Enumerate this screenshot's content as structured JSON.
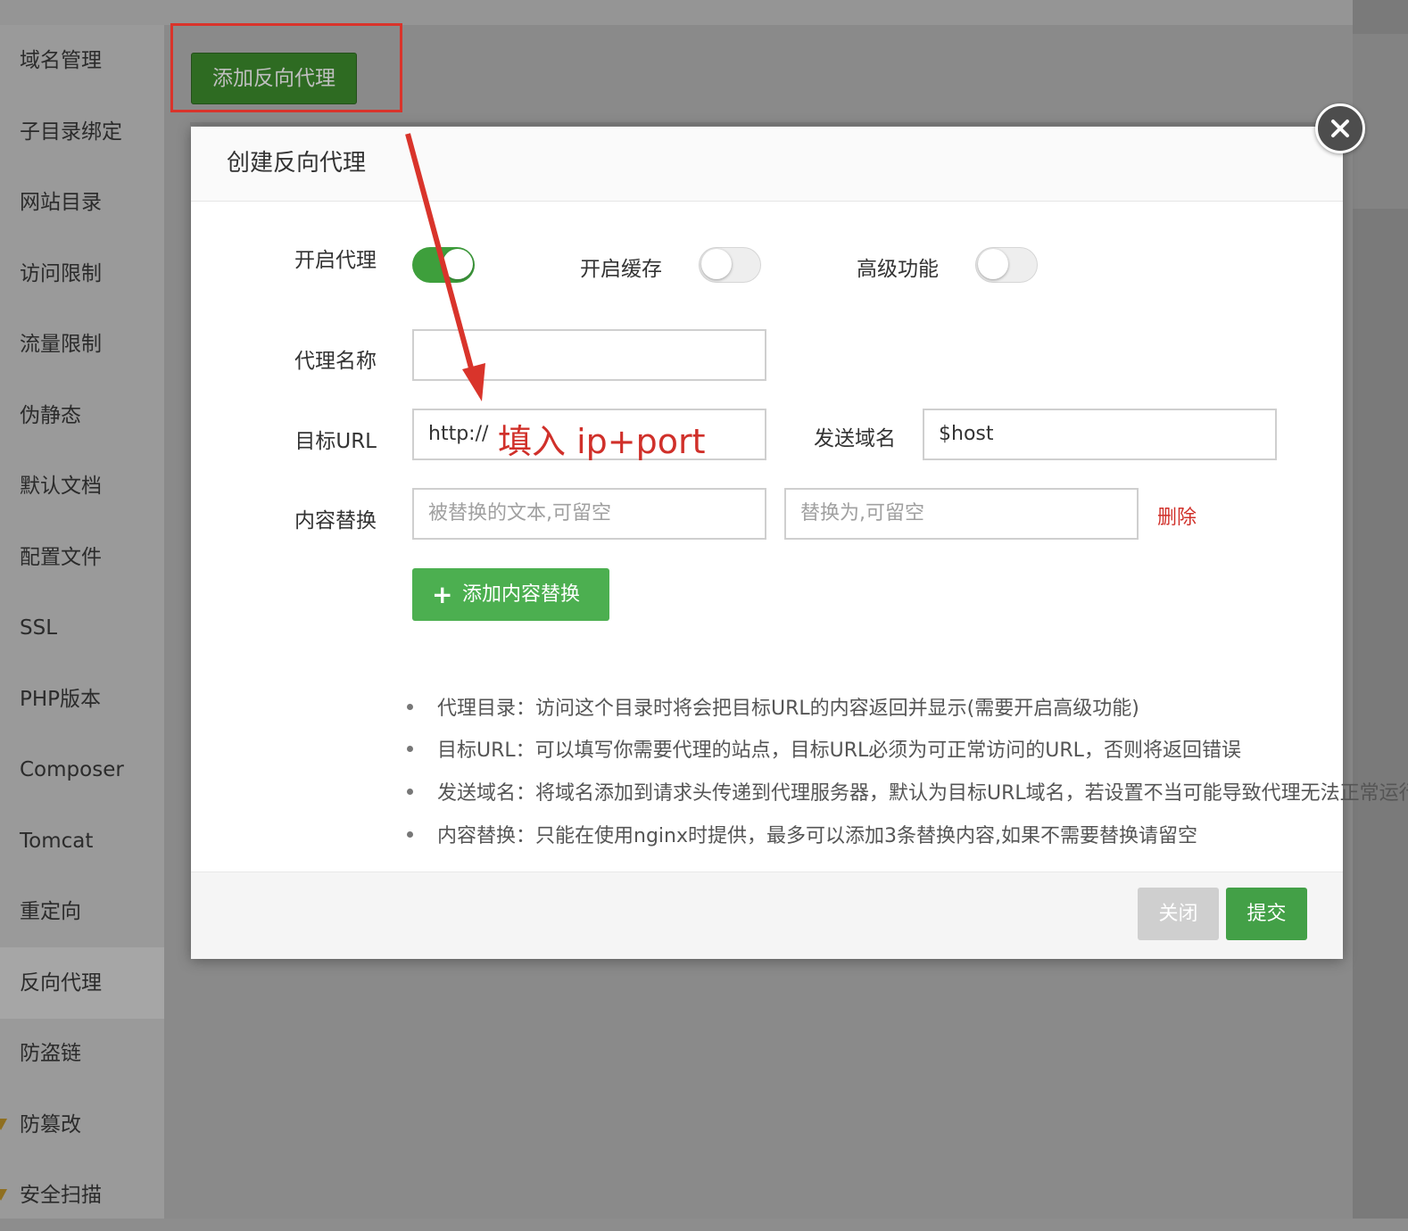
{
  "top_button": {
    "label": "添加反向代理"
  },
  "sidebar": {
    "items": [
      {
        "label": "域名管理"
      },
      {
        "label": "子目录绑定"
      },
      {
        "label": "网站目录"
      },
      {
        "label": "访问限制"
      },
      {
        "label": "流量限制"
      },
      {
        "label": "伪静态"
      },
      {
        "label": "默认文档"
      },
      {
        "label": "配置文件"
      },
      {
        "label": "SSL"
      },
      {
        "label": "PHP版本"
      },
      {
        "label": "Composer"
      },
      {
        "label": "Tomcat"
      },
      {
        "label": "重定向"
      },
      {
        "label": "反向代理",
        "active": true
      },
      {
        "label": "防盗链"
      },
      {
        "label": "防篡改",
        "premium_icon": "gem-icon"
      },
      {
        "label": "安全扫描",
        "premium_icon": "gem-icon"
      }
    ]
  },
  "dialog": {
    "title": "创建反向代理",
    "toggles": {
      "enable_proxy": {
        "label": "开启代理",
        "on": true
      },
      "enable_cache": {
        "label": "开启缓存",
        "on": false
      },
      "advanced": {
        "label": "高级功能",
        "on": false
      }
    },
    "proxy_name": {
      "label": "代理名称",
      "value": ""
    },
    "target_url": {
      "label": "目标URL",
      "value": "http://"
    },
    "send_domain": {
      "label": "发送域名",
      "value": "$host"
    },
    "content_replace": {
      "label": "内容替换",
      "from_placeholder": "被替换的文本,可留空",
      "to_placeholder": "替换为,可留空",
      "delete_label": "删除"
    },
    "add_replace_label": "添加内容替换",
    "notes": [
      "代理目录：访问这个目录时将会把目标URL的内容返回并显示(需要开启高级功能)",
      "目标URL：可以填写你需要代理的站点，目标URL必须为可正常访问的URL，否则将返回错误",
      "发送域名：将域名添加到请求头传递到代理服务器，默认为目标URL域名，若设置不当可能导致代理无法正常运行",
      "内容替换：只能在使用nginx时提供，最多可以添加3条替换内容,如果不需要替换请留空"
    ],
    "footer": {
      "close_label": "关闭",
      "submit_label": "提交"
    }
  },
  "annotation": {
    "hint_text": "填入 ip+port",
    "color": "#d0302a"
  },
  "colors": {
    "primary_green": "#4caf50",
    "toggle_on": "#3e9f3c",
    "danger_red": "#d0302a"
  }
}
